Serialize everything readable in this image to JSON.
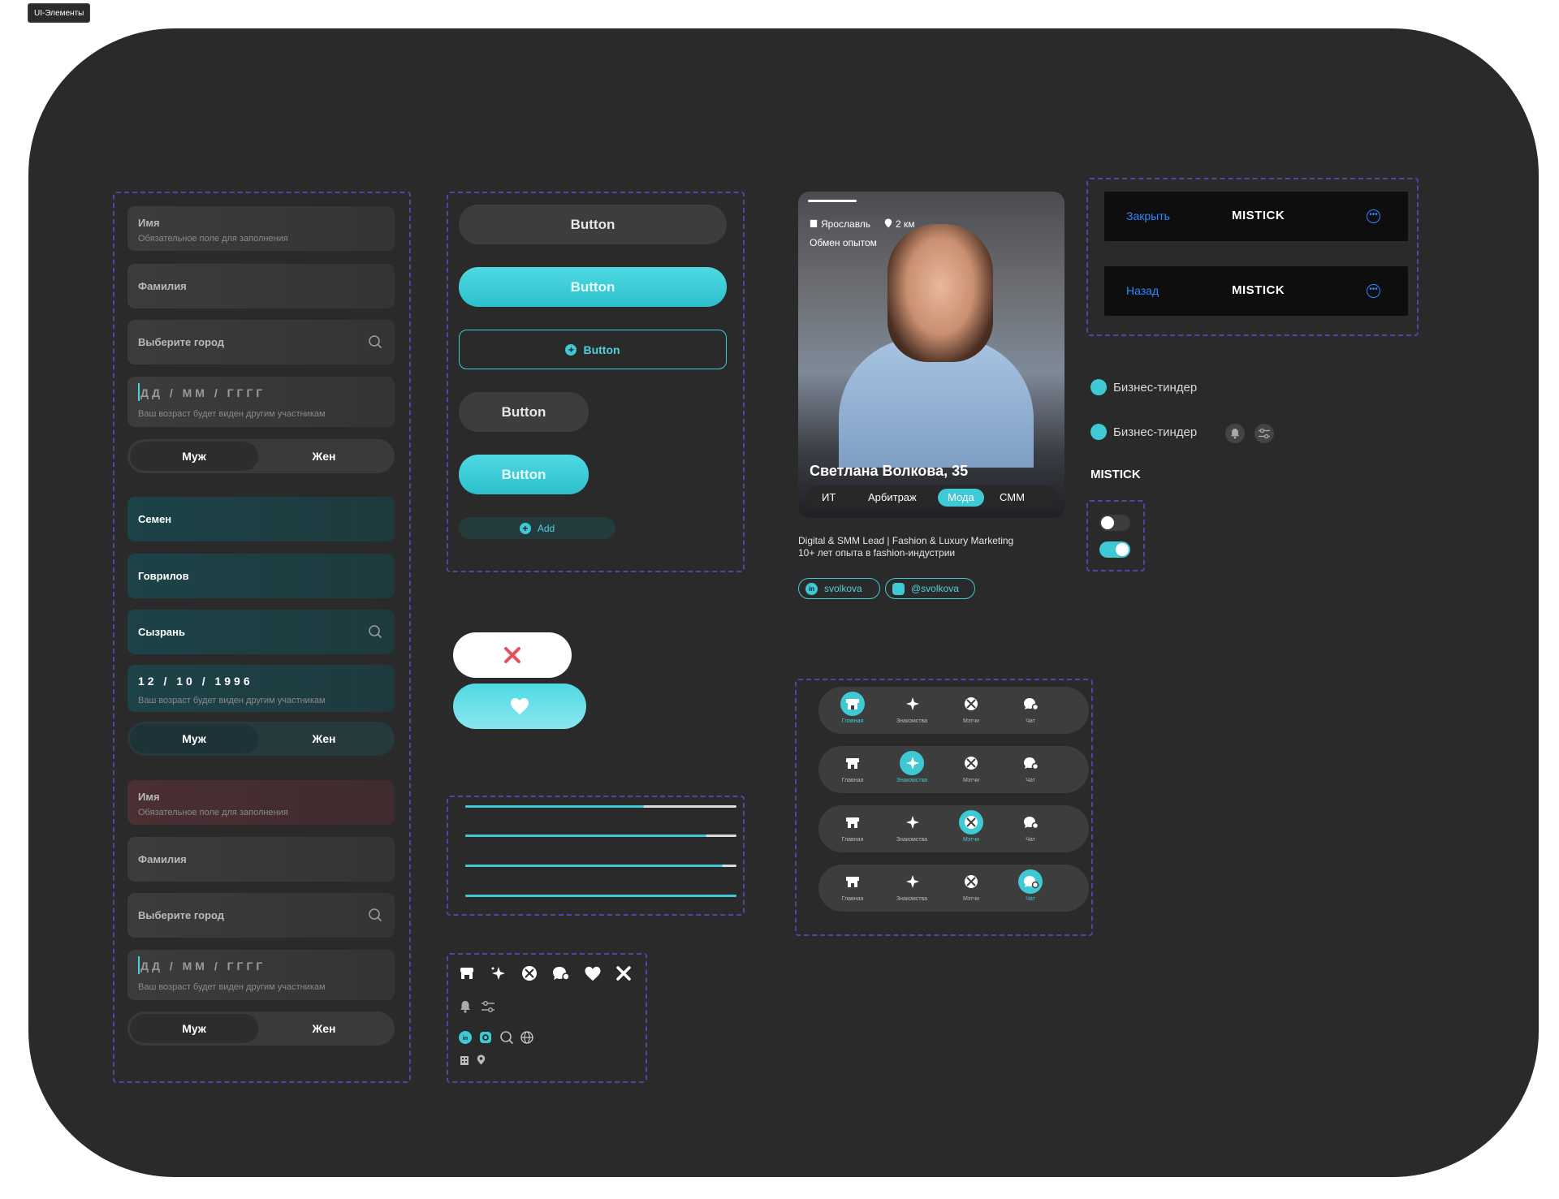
{
  "frame_label": "UI-Элементы",
  "colors": {
    "accent": "#3fc9d4",
    "bg": "#2a2a2a",
    "link": "#2f86ff",
    "error": "#4a2f33",
    "danger": "#e8505f"
  },
  "forms": {
    "set1": {
      "name": {
        "label": "Имя",
        "hint": "Обязательное поле для заполнения"
      },
      "surname": {
        "label": "Фамилия"
      },
      "city": {
        "placeholder": "Выберите город"
      },
      "date": {
        "value": "ДД / ММ / ГГГГ",
        "hint": "Ваш возраст будет виден другим участникам"
      },
      "gender": {
        "male": "Муж",
        "female": "Жен"
      }
    },
    "set2": {
      "name": {
        "value": "Семен"
      },
      "surname": {
        "value": "Говрилов"
      },
      "city": {
        "value": "Сызрань"
      },
      "date": {
        "value": "12 / 10 / 1996",
        "hint": "Ваш возраст будет виден другим участникам"
      },
      "gender": {
        "male": "Муж",
        "female": "Жен"
      }
    },
    "set3": {
      "name": {
        "label": "Имя",
        "hint": "Обязательное поле для заполнения"
      },
      "surname": {
        "label": "Фамилия"
      },
      "city": {
        "placeholder": "Выберите город"
      },
      "date": {
        "value": "ДД / ММ / ГГГГ",
        "hint": "Ваш возраст будет виден другим участникам"
      },
      "gender": {
        "male": "Муж",
        "female": "Жен"
      }
    }
  },
  "buttons": {
    "b1": "Button",
    "b2": "Button",
    "b3": "Button",
    "b4": "Button",
    "b5": "Button",
    "add": "Add"
  },
  "profile": {
    "city": "Ярославль",
    "distance": "2 км",
    "goal": "Обмен опытом",
    "name": "Светлана Волкова, 35",
    "chips": [
      "ИТ",
      "Арбитраж",
      "Мода",
      "СММ"
    ],
    "active_chip": "Мода",
    "desc_line1": "Digital & SMM Lead | Fashion & Luxury Marketing",
    "desc_line2": "10+ лет опыта в fashion-индустрии",
    "linkedin": "svolkova",
    "instagram": "@svolkova"
  },
  "headers": [
    {
      "back": "Закрыть",
      "logo": "MISTICK"
    },
    {
      "back": "Назад",
      "logo": "MISTICK"
    }
  ],
  "tags": {
    "t1": "Бизнес-тиндер",
    "t2": "Бизнес-тиндер"
  },
  "brand": "MISTICK",
  "toggles": [
    {
      "on": false
    },
    {
      "on": true
    }
  ],
  "progress": [
    0.66,
    0.89,
    0.95,
    1.0
  ],
  "tabbar": {
    "labels": [
      "Главная",
      "Знакомства",
      "Мэтчи",
      "Чат"
    ],
    "active_index_by_row": [
      0,
      1,
      2,
      3
    ]
  },
  "icons": [
    "shop-icon",
    "sparkle-icon",
    "matches-icon",
    "chat-icon",
    "heart-icon",
    "close-icon",
    "bell-icon",
    "filter-icon",
    "linkedin-icon",
    "instagram-icon",
    "search-icon",
    "globe-icon",
    "building-icon",
    "pin-icon"
  ]
}
